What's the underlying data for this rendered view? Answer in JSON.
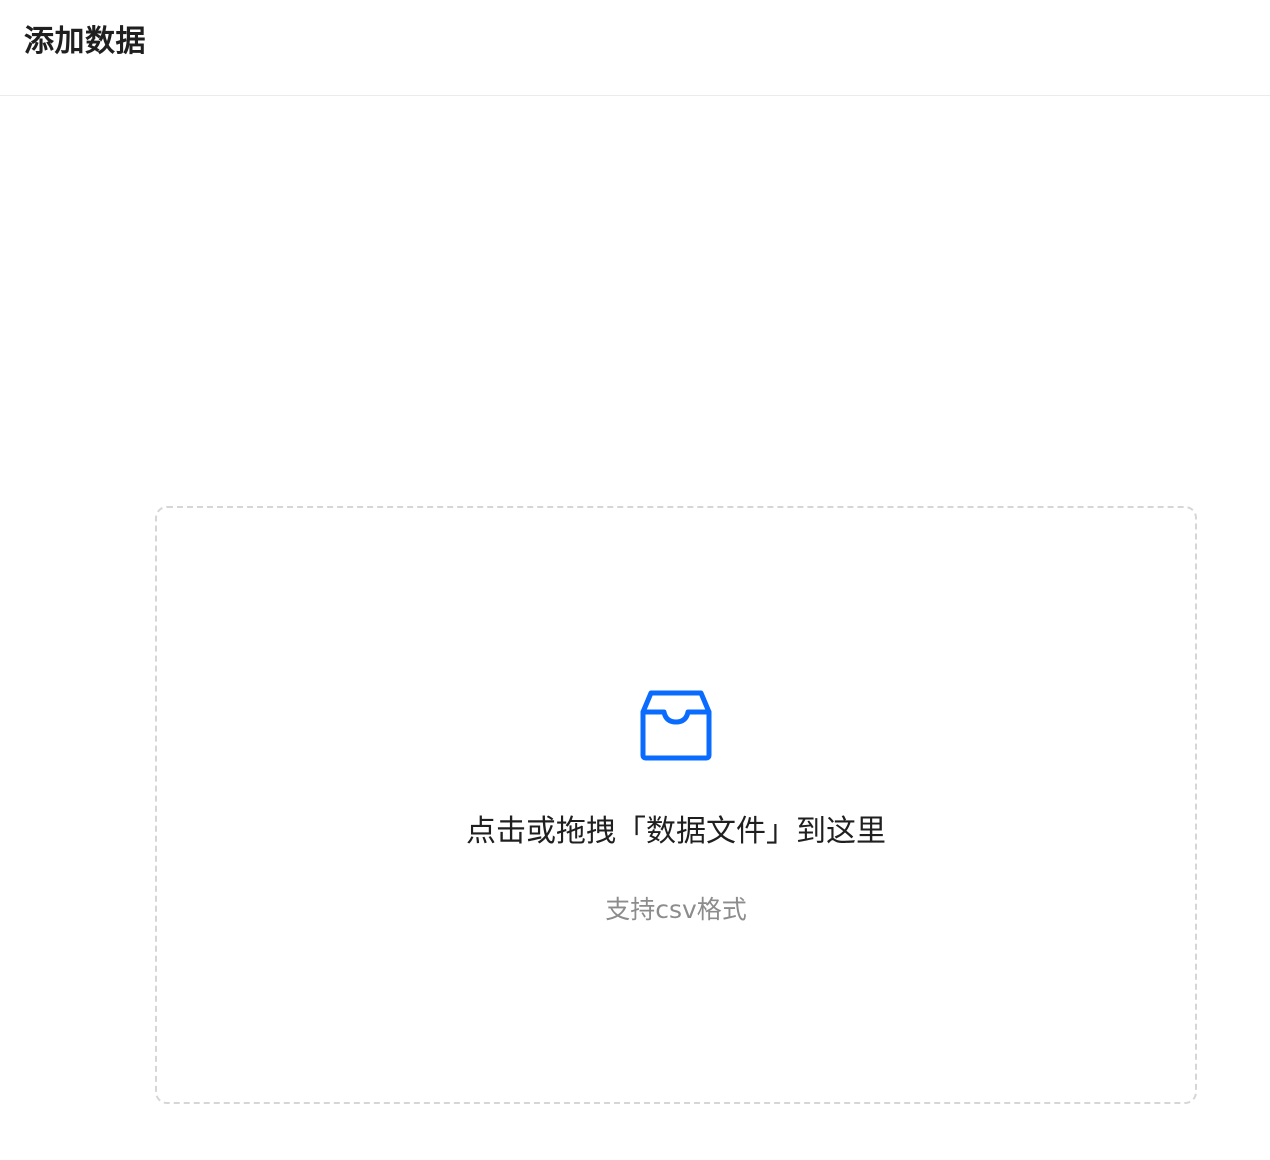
{
  "header": {
    "title": "添加数据"
  },
  "upload": {
    "icon": "inbox-icon",
    "accent_color": "#0a6cff",
    "title": "点击或拖拽「数据文件」到这里",
    "hint": "支持csv格式"
  }
}
